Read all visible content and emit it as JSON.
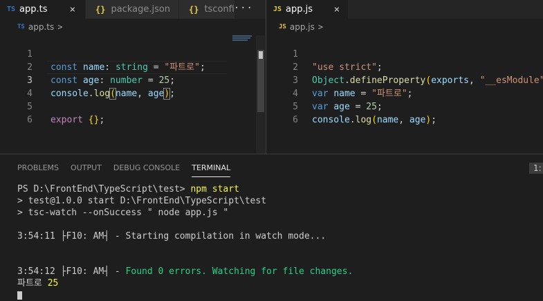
{
  "left_group": {
    "tabs": [
      {
        "icon": "TS",
        "label": "app.ts",
        "active": true,
        "close": "×"
      },
      {
        "icon": "{}",
        "label": "package.json",
        "active": false
      },
      {
        "icon": "{}",
        "label": "tsconfig",
        "active": false
      }
    ],
    "more": "···",
    "breadcrumb": {
      "icon": "TS",
      "file": "app.ts",
      "sep": ">"
    },
    "lines": [
      "1",
      "2",
      "3",
      "4",
      "5",
      "6"
    ]
  },
  "right_group": {
    "tab": {
      "icon": "JS",
      "label": "app.js",
      "close": "×"
    },
    "breadcrumb": {
      "icon": "JS",
      "file": "app.js",
      "sep": ">"
    },
    "lines": [
      "1",
      "2",
      "3",
      "4",
      "5",
      "6"
    ]
  },
  "code_ts": {
    "l1": {
      "kw": "const",
      "name": "name",
      "colon": ":",
      "type": "string",
      "eq": " = ",
      "str": "\"파트로\"",
      "end": ";"
    },
    "l2": {
      "kw": "const",
      "name": "age",
      "colon": ":",
      "type": "number",
      "eq": " = ",
      "num": "25",
      "end": ";"
    },
    "l3": {
      "obj": "console",
      "dot": ".",
      "fn": "log",
      "open": "(",
      "a1": "name",
      "comma": ", ",
      "a2": "age",
      "close": ")",
      "end": ";"
    },
    "l5": {
      "kw": "export",
      "braces": "{}",
      "end": ";"
    }
  },
  "code_js": {
    "l1": {
      "str": "\"use strict\"",
      "end": ";"
    },
    "l2": {
      "obj": "Object",
      "dot": ".",
      "fn": "defineProperty",
      "open": "(",
      "arg": "exports",
      "comma": ", ",
      "str": "\"__esModule\""
    },
    "l3": {
      "kw": "var",
      "name": "name",
      "eq": " = ",
      "str": "\"파트로\"",
      "end": ";"
    },
    "l4": {
      "kw": "var",
      "name": "age",
      "eq": " = ",
      "num": "25",
      "end": ";"
    },
    "l5": {
      "obj": "console",
      "dot": ".",
      "fn": "log",
      "open": "(",
      "a1": "name",
      "comma": ", ",
      "a2": "age",
      "close": ")",
      "end": ";"
    }
  },
  "panel": {
    "tabs": [
      "PROBLEMS",
      "OUTPUT",
      "DEBUG CONSOLE",
      "TERMINAL"
    ],
    "active_tab": "TERMINAL",
    "terminal_select": "1:"
  },
  "terminal": {
    "l1_prompt": "PS D:\\FrontEnd\\TypeScript\\test> ",
    "l1_cmd": "npm start",
    "l2": "> test@1.0.0 start D:\\FrontEnd\\TypeScript\\test",
    "l3": "> tsc-watch --onSuccess \" node app.js \"",
    "l5": "3:54:11 ├F10: AM┤ - Starting compilation in watch mode...",
    "l8_time": "3:54:12 ├F10: AM┤ - ",
    "l8_msg": "Found 0 errors. Watching for file changes.",
    "l9_text": "파트로 ",
    "l9_num": "25"
  }
}
